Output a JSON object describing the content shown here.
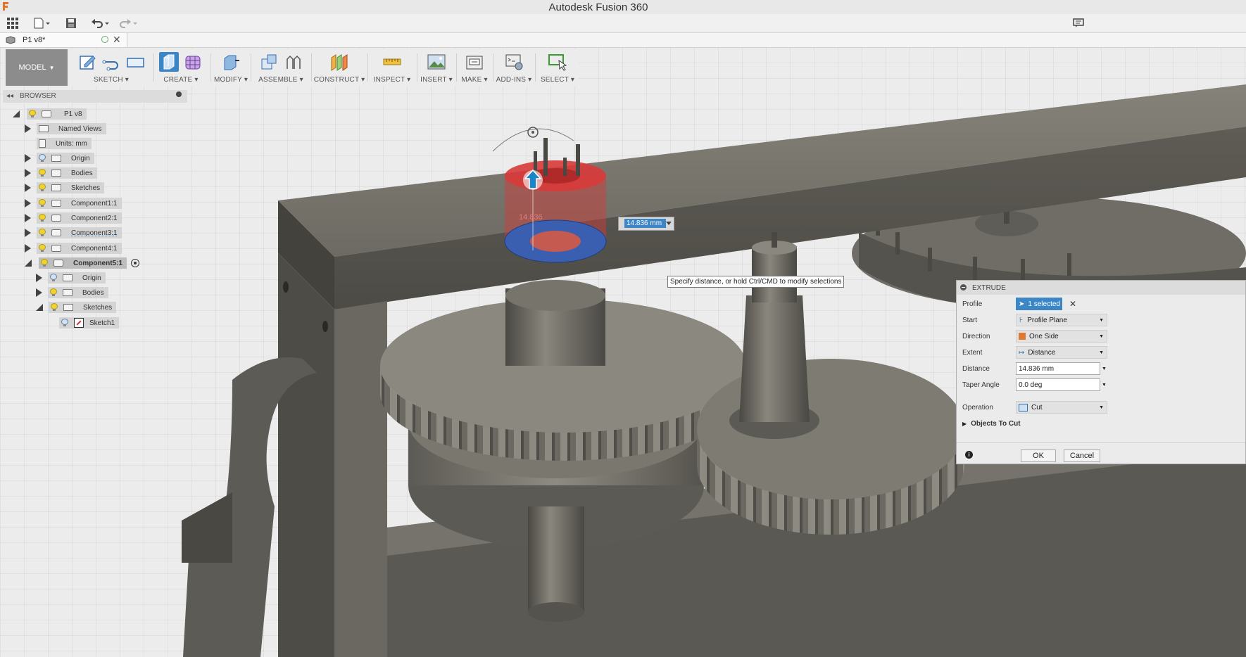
{
  "app": {
    "title": "Autodesk Fusion 360"
  },
  "document": {
    "tab_label": "P1 v8*"
  },
  "toolbar": {
    "workspace": "MODEL",
    "groups": {
      "sketch": "SKETCH",
      "create": "CREATE",
      "modify": "MODIFY",
      "assemble": "ASSEMBLE",
      "construct": "CONSTRUCT",
      "inspect": "INSPECT",
      "insert": "INSERT",
      "make": "MAKE",
      "addins": "ADD-INS",
      "select": "SELECT"
    }
  },
  "browser": {
    "title": "BROWSER",
    "nodes": [
      {
        "label": "P1 v8"
      },
      {
        "label": "Named Views"
      },
      {
        "label": "Units: mm"
      },
      {
        "label": "Origin"
      },
      {
        "label": "Bodies"
      },
      {
        "label": "Sketches"
      },
      {
        "label": "Component1:1"
      },
      {
        "label": "Component2:1"
      },
      {
        "label": "Component3:1"
      },
      {
        "label": "Component4:1"
      },
      {
        "label": "Component5:1"
      },
      {
        "label": "Origin"
      },
      {
        "label": "Bodies"
      },
      {
        "label": "Sketches"
      },
      {
        "label": "Sketch1"
      }
    ]
  },
  "viewport": {
    "dimension_label": "14.836",
    "distance_input": "14.836 mm",
    "tooltip": "Specify distance, or hold Ctrl/CMD to modify selections"
  },
  "extrude": {
    "title": "EXTRUDE",
    "rows": {
      "profile": {
        "label": "Profile",
        "value": "1 selected"
      },
      "start": {
        "label": "Start",
        "value": "Profile Plane"
      },
      "direction": {
        "label": "Direction",
        "value": "One Side"
      },
      "extent": {
        "label": "Extent",
        "value": "Distance"
      },
      "distance": {
        "label": "Distance",
        "value": "14.836 mm"
      },
      "taper": {
        "label": "Taper Angle",
        "value": "0.0 deg"
      },
      "operation": {
        "label": "Operation",
        "value": "Cut"
      }
    },
    "objects_to_cut": "Objects To Cut",
    "ok": "OK",
    "cancel": "Cancel"
  },
  "colors": {
    "accent": "#3d86c6",
    "model_bg": "#8c8c8c",
    "profile_blue": "#3a5fb0",
    "extrude_red": "#d83a3a",
    "geometry": "#66645c"
  }
}
